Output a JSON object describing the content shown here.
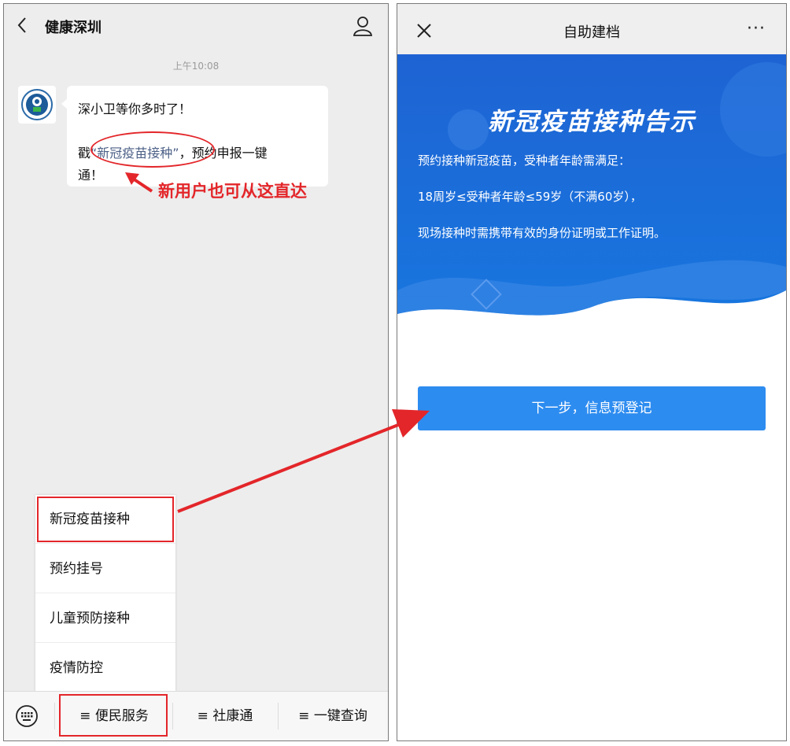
{
  "left": {
    "header": {
      "title": "健康深圳",
      "back_icon": "chevron-left-icon",
      "profile_icon": "person-icon"
    },
    "timestamp": "上午10:08",
    "message": {
      "line1": "深小卫等你多时了！",
      "line2_prefix": "戳",
      "line2_link": "“新冠疫苗接种”",
      "line2_suffix": "，预约申报一键",
      "line3": "通！"
    },
    "callout": "新用户也可从这直达",
    "menu": [
      "新冠疫苗接种",
      "预约挂号",
      "儿童预防接种",
      "疫情防控"
    ],
    "bottom_tabs": [
      "≡ 便民服务",
      "≡ 社康通",
      "≡ 一键查询"
    ],
    "keyboard_icon": "keyboard-icon"
  },
  "right": {
    "header": {
      "title": "自助建档",
      "close_icon": "close-icon",
      "more_icon": "more-icon",
      "more_text": "···"
    },
    "banner": {
      "title": "新冠疫苗接种告示",
      "lines": [
        "预约接种新冠疫苗，受种者年龄需满足：",
        "18周岁≤受种者年龄≤59岁（不满60岁），",
        "现场接种时需携带有效的身份证明或工作证明。"
      ]
    },
    "next_button": "下一步，信息预登记"
  },
  "colors": {
    "annotation_red": "#e3262a",
    "banner_blue": "#1f66d6",
    "button_blue": "#2d8cf0"
  }
}
